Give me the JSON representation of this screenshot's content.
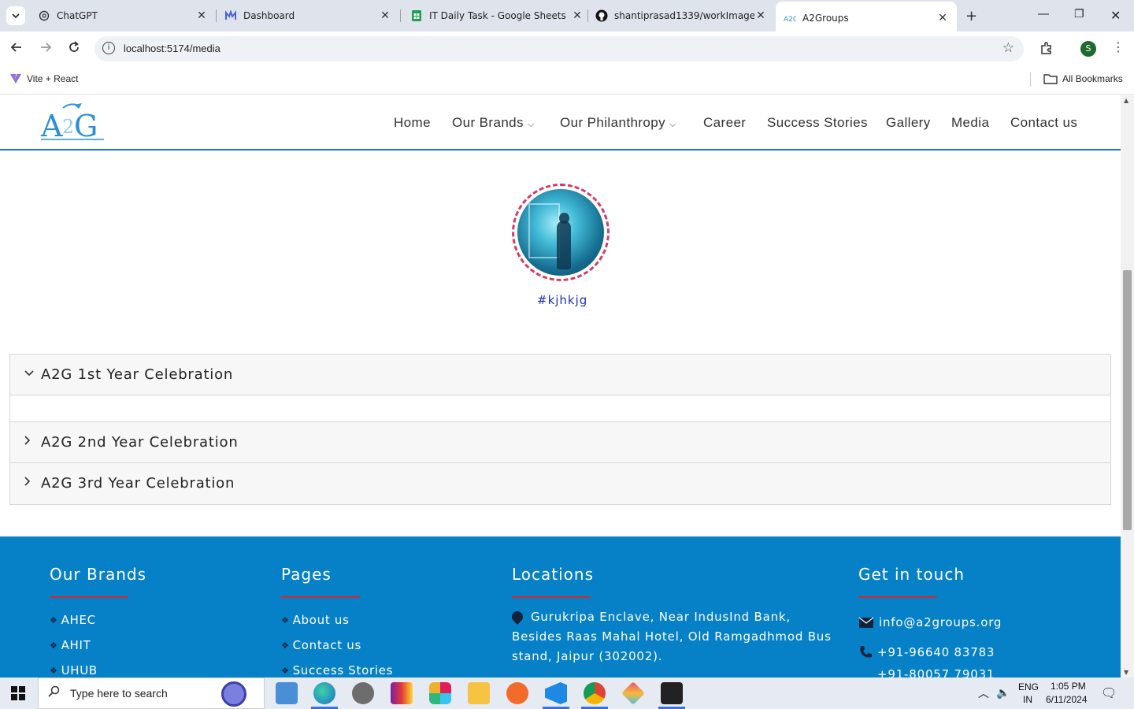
{
  "browser": {
    "tabs": [
      {
        "title": "ChatGPT",
        "icon": "chatgpt-icon"
      },
      {
        "title": "Dashboard",
        "icon": "dashboard-icon"
      },
      {
        "title": "IT Daily Task - Google Sheets",
        "icon": "sheets-icon"
      },
      {
        "title": "shantiprasad1339/workImages",
        "icon": "github-icon"
      },
      {
        "title": "A2Groups",
        "icon": "a2g-icon",
        "active": true
      }
    ],
    "url": "localhost:5174/media",
    "profile_initial": "S",
    "bookmarks": {
      "item": "Vite + React",
      "all": "All Bookmarks"
    }
  },
  "site": {
    "logo_text": "A2G",
    "nav": [
      "Home",
      "Our Brands",
      "Our Philanthropy",
      "Career",
      "Success Stories",
      "Gallery",
      "Media",
      "Contact us"
    ],
    "story_caption": "#kjhkjg",
    "accordion": [
      {
        "label": "A2G 1st Year Celebration",
        "expanded": true
      },
      {
        "label": "A2G 2nd Year Celebration",
        "expanded": false
      },
      {
        "label": "A2G 3rd Year Celebration",
        "expanded": false
      }
    ],
    "footer": {
      "brands_title": "Our Brands",
      "brands": [
        "AHEC",
        "AHIT",
        "UHUB"
      ],
      "pages_title": "Pages",
      "pages": [
        "About us",
        "Contact us",
        "Success Stories"
      ],
      "locations_title": "Locations",
      "address": "Gurukripa Enclave, Near IndusInd Bank, Besides Raas Mahal Hotel, Old Ramgadhmod Bus stand, Jaipur (302002).",
      "contact_title": "Get in touch",
      "email": "info@a2groups.org",
      "phone1": "+91-96640 83783",
      "phone2": "+91-80057 79031"
    },
    "colors": {
      "footer_bg": "#0680c6",
      "accent_red": "#d22a2a",
      "story_ring": "#d33c6b"
    }
  },
  "taskbar": {
    "search_placeholder": "Type here to search",
    "lang": "ENG",
    "region": "IN",
    "time": "1:05 PM",
    "date": "6/11/2024"
  }
}
